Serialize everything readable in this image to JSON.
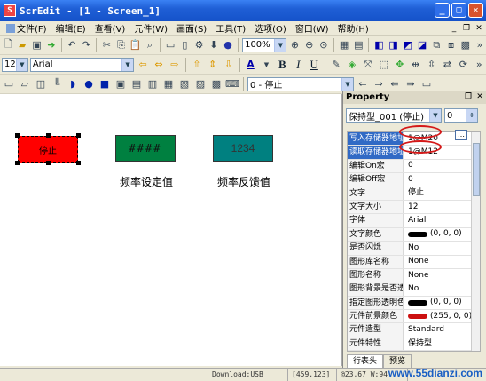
{
  "app": {
    "title": "ScrEdit  -  [1 - Screen_1]",
    "icon_label": "S"
  },
  "menu": [
    {
      "label": "文件(F)",
      "icon": "file-menu-icon"
    },
    {
      "label": "编辑(E)"
    },
    {
      "label": "查看(V)"
    },
    {
      "label": "元件(W)"
    },
    {
      "label": "画面(S)"
    },
    {
      "label": "工具(T)"
    },
    {
      "label": "选项(O)"
    },
    {
      "label": "窗口(W)"
    },
    {
      "label": "帮助(H)"
    }
  ],
  "toolbar1": {
    "zoom": "100%"
  },
  "toolbar2": {
    "font_size": "12",
    "font_name": "Arial",
    "bold": "B",
    "italic": "I",
    "underline": "U",
    "font_color": "A"
  },
  "toolbar3": {
    "state_value": "0 - 停止"
  },
  "canvas": {
    "stop_button_label": "停止",
    "freq_set_display": "####",
    "freq_set_caption": "频率设定值",
    "freq_feedback_display": "1234",
    "freq_feedback_caption": "频率反馈值",
    "colors": {
      "stop_button": "#ff0000",
      "freq_set": "#008040",
      "freq_feedback": "#008080"
    }
  },
  "property": {
    "title": "Property",
    "object_select": "保持型_001 (停止)",
    "state_value": "0",
    "rows": [
      {
        "key": "写入存储器地址",
        "value": "1@M20"
      },
      {
        "key": "读取存储器地址",
        "value": "1@M12"
      },
      {
        "key": "编辑On宏",
        "value": "0"
      },
      {
        "key": "编辑Off宏",
        "value": "0"
      },
      {
        "key": "文字",
        "value": "停止"
      },
      {
        "key": "文字大小",
        "value": "12"
      },
      {
        "key": "字体",
        "value": "Arial"
      },
      {
        "key": "文字颜色",
        "value": "(0, 0, 0)",
        "swatch": "#000000"
      },
      {
        "key": "是否闪烁",
        "value": "No"
      },
      {
        "key": "图形库名称",
        "value": "None"
      },
      {
        "key": "图形名称",
        "value": "None"
      },
      {
        "key": "图形背景是否透",
        "value": "No"
      },
      {
        "key": "指定图形透明色",
        "value": "(0, 0, 0)",
        "swatch": "#000000"
      },
      {
        "key": "元件前景颜色",
        "value": "(255, 0, 0)",
        "swatch": "#cc1010"
      },
      {
        "key": "元件造型",
        "value": "Standard"
      },
      {
        "key": "元件特性",
        "value": "保持型"
      }
    ],
    "tabs": [
      "行表头",
      "预览"
    ]
  },
  "status": {
    "download": "Download:USB",
    "coords": "[459,123]",
    "size": "@23,67 W:94",
    "watermark": "www.55dianzi.com"
  }
}
